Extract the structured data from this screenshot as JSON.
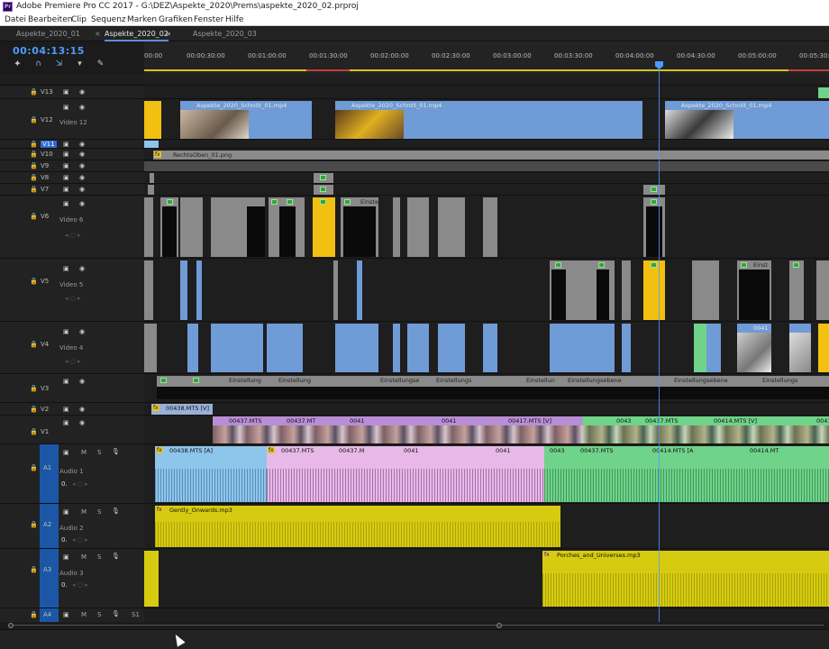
{
  "window": {
    "title": "Adobe Premiere Pro CC 2017 - G:\\DEZ\\Aspekte_2020\\Prems\\aspekte_2020_02.prproj",
    "app_icon": "Pr"
  },
  "menu": [
    "Datei",
    "Bearbeiten",
    "Clip",
    "Sequenz",
    "Marken",
    "Grafiken",
    "Fenster",
    "Hilfe"
  ],
  "tabs": [
    {
      "label": "Aspekte_2020_01",
      "active": false
    },
    {
      "label": "Aspekte_2020_02",
      "active": true
    },
    {
      "label": "Aspekte_2020_03",
      "active": false
    }
  ],
  "timecode": "00:04:13:15",
  "ruler": [
    "00:00",
    "00:00:30:00",
    "00:01:00:00",
    "00:01:30:00",
    "00:02:00:00",
    "00:02:30:00",
    "00:03:00:00",
    "00:03:30:00",
    "00:04:00:00",
    "00:04:30:00",
    "00:05:00:00",
    "00:05:30:00"
  ],
  "tracks": {
    "video": [
      {
        "id": "V13",
        "name": ""
      },
      {
        "id": "V12",
        "name": "Video 12"
      },
      {
        "id": "V11",
        "name": ""
      },
      {
        "id": "V10",
        "name": ""
      },
      {
        "id": "V9",
        "name": ""
      },
      {
        "id": "V8",
        "name": ""
      },
      {
        "id": "V7",
        "name": ""
      },
      {
        "id": "V6",
        "name": "Video 6"
      },
      {
        "id": "V5",
        "name": "Video 5"
      },
      {
        "id": "V4",
        "name": "Video 4"
      },
      {
        "id": "V3",
        "name": ""
      },
      {
        "id": "V2",
        "name": ""
      },
      {
        "id": "V1",
        "name": ""
      }
    ],
    "audio": [
      {
        "id": "A1",
        "name": "Audio 1",
        "vol": "0."
      },
      {
        "id": "A2",
        "name": "Audio 2",
        "vol": "0."
      },
      {
        "id": "A3",
        "name": "Audio 3",
        "vol": "0."
      },
      {
        "id": "A4",
        "name": "",
        "vol": ""
      }
    ],
    "a4_right": "S1"
  },
  "clips": {
    "schnitt": "Aspekte_2020_Schnitt_01.mp4",
    "rechts": "RechtsOben_01.png",
    "einst": "Einstellungsebene",
    "einst_short1": "Einstellung",
    "einst_short2": "Einstell",
    "einst_short3": "Einstellungse",
    "einst_short4": "Einstellun",
    "einst_short5": "Einstellungs",
    "einst_short6": "Einst",
    "einst_short7": "Einste",
    "v2_label": "00438.MTS [V]",
    "v1_a": "00437.MTS",
    "v1_b": "00437.MT",
    "v1_c": "0041",
    "v1_d": "00417.MTS [V]",
    "v1_e": "0043",
    "v1_f": "00414.MTS [V]",
    "v1_g": "00414.MT",
    "v4_a": "0041",
    "a1_a": "00438.MTS [A]",
    "a1_b": "00437.MTS",
    "a1_c": "00437.M",
    "a1_d": "00414.MTS [A",
    "a2": "Gently_Onwards.mp3",
    "a3": "Porches_and_Universes.mp3",
    "fx": "fx"
  },
  "icons": {
    "lock": "lock-icon",
    "eye": "eye-icon",
    "film": "toggle-sync-icon",
    "mic": "mic-icon"
  }
}
